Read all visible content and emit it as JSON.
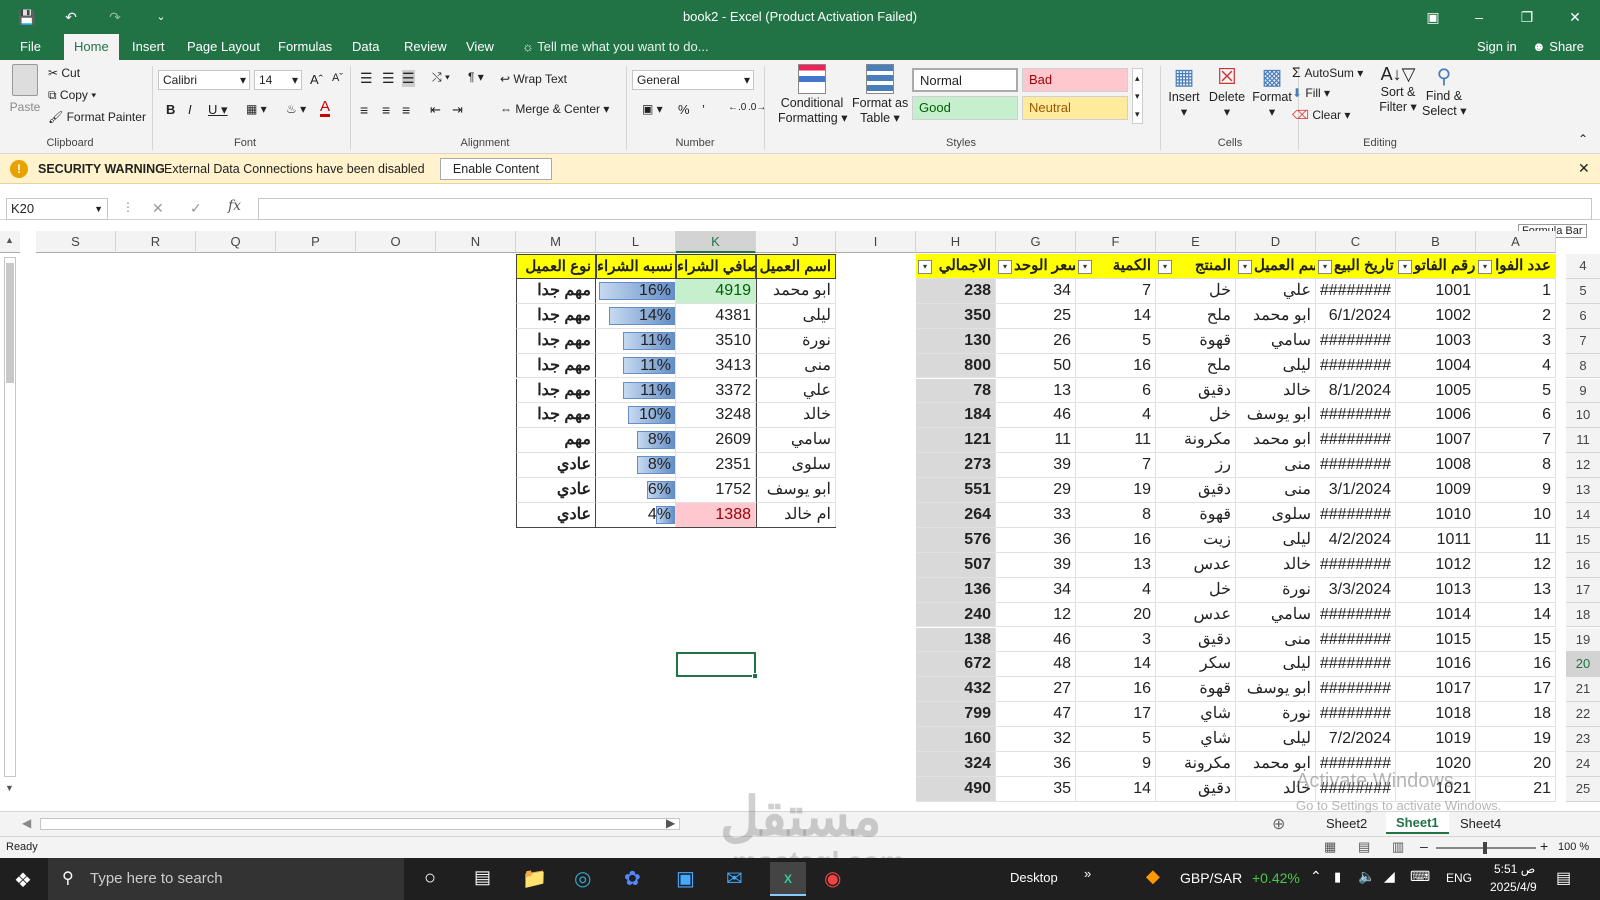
{
  "window": {
    "title": "book2 - Excel (Product Activation Failed)"
  },
  "menu": {
    "tabs": [
      "File",
      "Home",
      "Insert",
      "Page Layout",
      "Formulas",
      "Data",
      "Review",
      "View"
    ],
    "tell_me": "Tell me what you want to do...",
    "sign_in": "Sign in",
    "share": "Share"
  },
  "ribbon": {
    "clipboard": {
      "paste": "Paste",
      "cut": "Cut",
      "copy": "Copy",
      "format_painter": "Format Painter",
      "label": "Clipboard"
    },
    "font": {
      "name": "Calibri",
      "size": "14",
      "label": "Font"
    },
    "alignment": {
      "wrap": "Wrap Text",
      "merge": "Merge & Center",
      "label": "Alignment"
    },
    "number": {
      "format": "General",
      "label": "Number"
    },
    "styles": {
      "cond1": "Conditional",
      "cond2": "Formatting",
      "fmt1": "Format as",
      "fmt2": "Table",
      "normal": "Normal",
      "bad": "Bad",
      "good": "Good",
      "neutral": "Neutral",
      "label": "Styles"
    },
    "cells": {
      "insert": "Insert",
      "delete": "Delete",
      "format": "Format",
      "label": "Cells"
    },
    "editing": {
      "autosum": "AutoSum",
      "fill": "Fill",
      "clear": "Clear",
      "sort1": "Sort &",
      "sort2": "Filter",
      "find1": "Find &",
      "find2": "Select",
      "label": "Editing"
    }
  },
  "security": {
    "title": "SECURITY WARNING",
    "message": "External Data Connections have been disabled",
    "button": "Enable Content"
  },
  "formula": {
    "namebox": "K20",
    "fx": "fx",
    "tooltip": "Formula Bar"
  },
  "columns": [
    "S",
    "R",
    "Q",
    "P",
    "O",
    "N",
    "M",
    "L",
    "K",
    "J",
    "I",
    "H",
    "G",
    "F",
    "E",
    "D",
    "C",
    "B",
    "A"
  ],
  "row_numbers": [
    "4",
    "5",
    "6",
    "7",
    "8",
    "9",
    "10",
    "11",
    "12",
    "13",
    "14",
    "15",
    "16",
    "17",
    "18",
    "19",
    "20",
    "21",
    "22",
    "23",
    "24",
    "25"
  ],
  "table_left": {
    "headers": {
      "M": "نوع العميل",
      "L": "نسبه الشراء",
      "K": "صافي الشراء",
      "J": "اسم العميل"
    },
    "rows": [
      {
        "name": "ابو محمد",
        "net": "4919",
        "pct": "16%",
        "pctv": 16,
        "type": "مهم جدا"
      },
      {
        "name": "ليلى",
        "net": "4381",
        "pct": "14%",
        "pctv": 14,
        "type": "مهم جدا"
      },
      {
        "name": "نورة",
        "net": "3510",
        "pct": "11%",
        "pctv": 11,
        "type": "مهم جدا"
      },
      {
        "name": "منى",
        "net": "3413",
        "pct": "11%",
        "pctv": 11,
        "type": "مهم جدا"
      },
      {
        "name": "علي",
        "net": "3372",
        "pct": "11%",
        "pctv": 11,
        "type": "مهم جدا"
      },
      {
        "name": "خالد",
        "net": "3248",
        "pct": "10%",
        "pctv": 10,
        "type": "مهم جدا"
      },
      {
        "name": "سامي",
        "net": "2609",
        "pct": "8%",
        "pctv": 8,
        "type": "مهم"
      },
      {
        "name": "سلوى",
        "net": "2351",
        "pct": "8%",
        "pctv": 8,
        "type": "عادي"
      },
      {
        "name": "ابو يوسف",
        "net": "1752",
        "pct": "6%",
        "pctv": 6,
        "type": "عادي"
      },
      {
        "name": "ام خالد",
        "net": "1388",
        "pct": "4%",
        "pctv": 4,
        "type": "عادي"
      }
    ]
  },
  "table_right": {
    "headers": {
      "H": "الاجمالي",
      "G": "سعر الوحد",
      "F": "الكمية",
      "E": "المنتج",
      "D": "اسم العميل",
      "C": "تاريخ البيع",
      "B": "رقم الفاتو",
      "A": "عدد الفوا"
    },
    "rows": [
      {
        "h": "238",
        "g": "34",
        "f": "7",
        "e": "خل",
        "d": "علي",
        "c": "########",
        "b": "1001",
        "a": "1"
      },
      {
        "h": "350",
        "g": "25",
        "f": "14",
        "e": "ملح",
        "d": "ابو محمد",
        "c": "6/1/2024",
        "b": "1002",
        "a": "2"
      },
      {
        "h": "130",
        "g": "26",
        "f": "5",
        "e": "قهوة",
        "d": "سامي",
        "c": "########",
        "b": "1003",
        "a": "3"
      },
      {
        "h": "800",
        "g": "50",
        "f": "16",
        "e": "ملح",
        "d": "ليلى",
        "c": "########",
        "b": "1004",
        "a": "4"
      },
      {
        "h": "78",
        "g": "13",
        "f": "6",
        "e": "دقيق",
        "d": "خالد",
        "c": "8/1/2024",
        "b": "1005",
        "a": "5"
      },
      {
        "h": "184",
        "g": "46",
        "f": "4",
        "e": "خل",
        "d": "ابو يوسف",
        "c": "########",
        "b": "1006",
        "a": "6"
      },
      {
        "h": "121",
        "g": "11",
        "f": "11",
        "e": "مكرونة",
        "d": "ابو محمد",
        "c": "########",
        "b": "1007",
        "a": "7"
      },
      {
        "h": "273",
        "g": "39",
        "f": "7",
        "e": "رز",
        "d": "منى",
        "c": "########",
        "b": "1008",
        "a": "8"
      },
      {
        "h": "551",
        "g": "29",
        "f": "19",
        "e": "دقيق",
        "d": "منى",
        "c": "3/1/2024",
        "b": "1009",
        "a": "9"
      },
      {
        "h": "264",
        "g": "33",
        "f": "8",
        "e": "قهوة",
        "d": "سلوى",
        "c": "########",
        "b": "1010",
        "a": "10"
      },
      {
        "h": "576",
        "g": "36",
        "f": "16",
        "e": "زيت",
        "d": "ليلى",
        "c": "4/2/2024",
        "b": "1011",
        "a": "11"
      },
      {
        "h": "507",
        "g": "39",
        "f": "13",
        "e": "عدس",
        "d": "خالد",
        "c": "########",
        "b": "1012",
        "a": "12"
      },
      {
        "h": "136",
        "g": "34",
        "f": "4",
        "e": "خل",
        "d": "نورة",
        "c": "3/3/2024",
        "b": "1013",
        "a": "13"
      },
      {
        "h": "240",
        "g": "12",
        "f": "20",
        "e": "عدس",
        "d": "سامي",
        "c": "########",
        "b": "1014",
        "a": "14"
      },
      {
        "h": "138",
        "g": "46",
        "f": "3",
        "e": "دقيق",
        "d": "منى",
        "c": "########",
        "b": "1015",
        "a": "15"
      },
      {
        "h": "672",
        "g": "48",
        "f": "14",
        "e": "سكر",
        "d": "ليلى",
        "c": "########",
        "b": "1016",
        "a": "16"
      },
      {
        "h": "432",
        "g": "27",
        "f": "16",
        "e": "قهوة",
        "d": "ابو يوسف",
        "c": "########",
        "b": "1017",
        "a": "17"
      },
      {
        "h": "799",
        "g": "47",
        "f": "17",
        "e": "شاي",
        "d": "نورة",
        "c": "########",
        "b": "1018",
        "a": "18"
      },
      {
        "h": "160",
        "g": "32",
        "f": "5",
        "e": "شاي",
        "d": "ليلى",
        "c": "7/2/2024",
        "b": "1019",
        "a": "19"
      },
      {
        "h": "324",
        "g": "36",
        "f": "9",
        "e": "مكرونة",
        "d": "ابو محمد",
        "c": "########",
        "b": "1020",
        "a": "20"
      },
      {
        "h": "490",
        "g": "35",
        "f": "14",
        "e": "دقيق",
        "d": "خالد",
        "c": "########",
        "b": "1021",
        "a": "21"
      }
    ]
  },
  "sheets": [
    "Sheet2",
    "Sheet1",
    "Sheet4"
  ],
  "active_sheet": "Sheet1",
  "status": {
    "ready": "Ready",
    "zoom": "100 %"
  },
  "watermark": {
    "activate1": "Activate Windows",
    "activate2": "Go to Settings to activate Windows.",
    "site": "mostaql.com",
    "logo": "مستقل"
  },
  "taskbar": {
    "search": "Type here to search",
    "desktop": "Desktop",
    "ticker": "GBP/SAR",
    "change": "+0.42%",
    "lang": "ENG",
    "time": "5:51 ص",
    "date": "2025/4/9"
  }
}
